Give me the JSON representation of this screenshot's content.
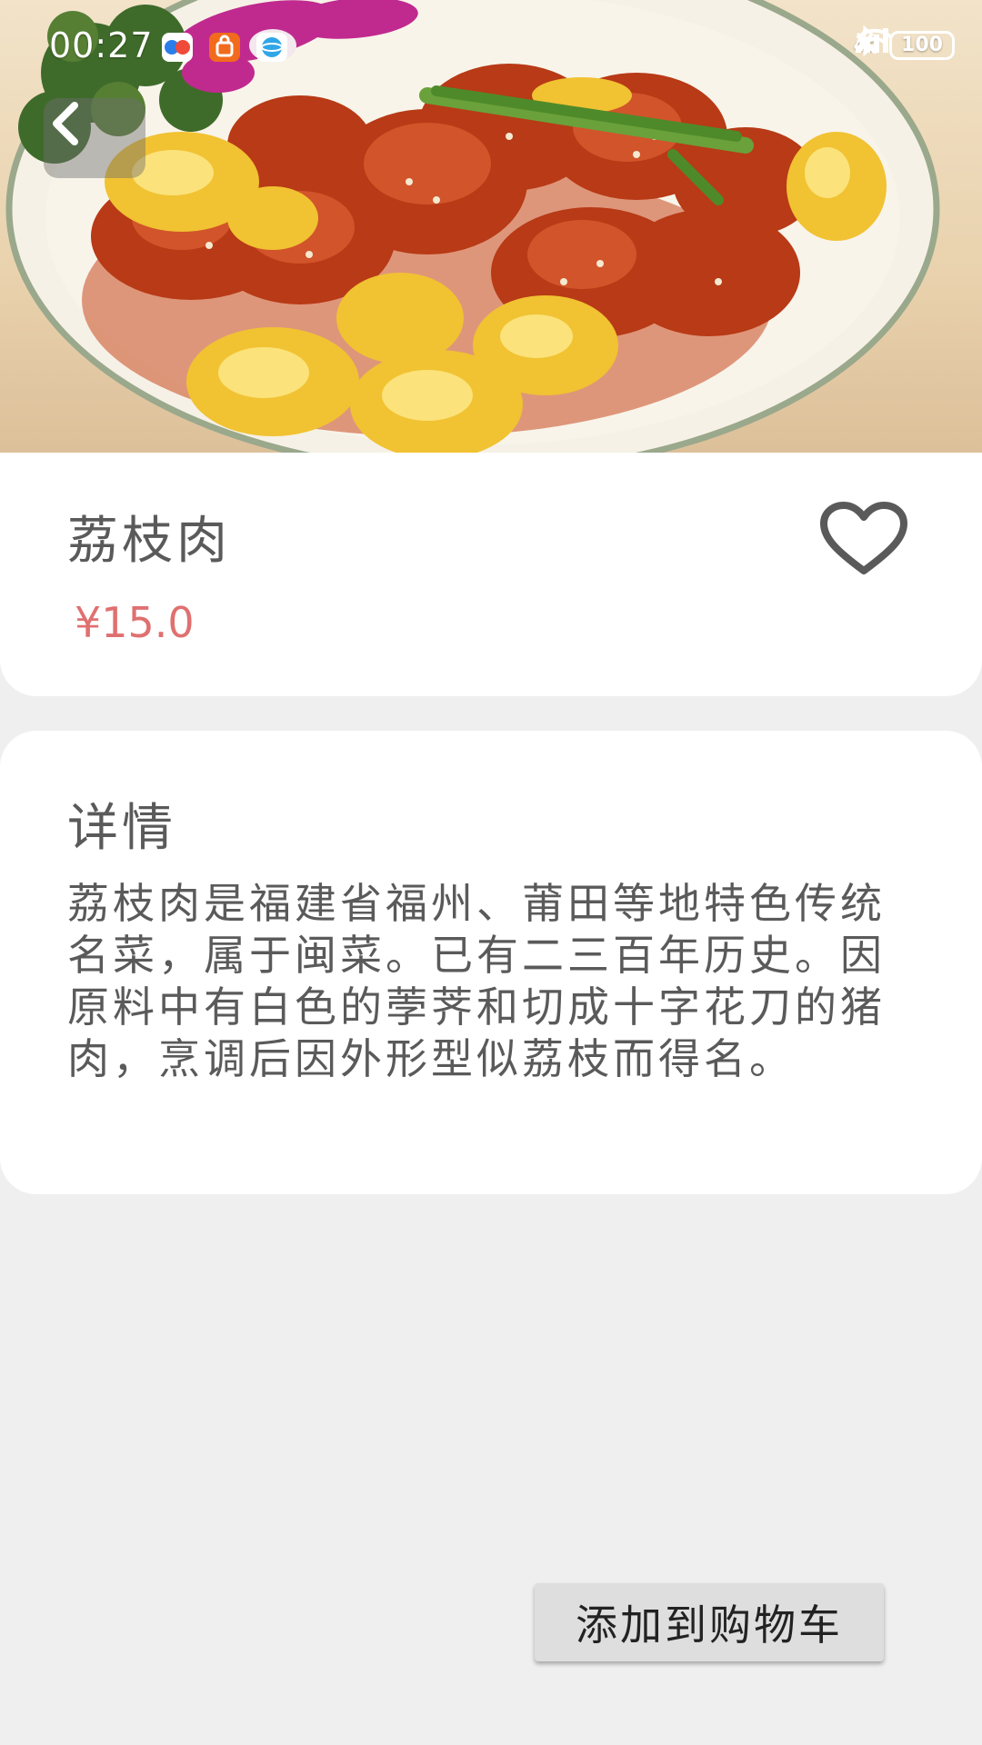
{
  "status_bar": {
    "time": "00:27",
    "network": "4G",
    "battery": "100"
  },
  "dish": {
    "name": "荔枝肉",
    "price": "¥15.0"
  },
  "details": {
    "heading": "详情",
    "description": "荔枝肉是福建省福州、莆田等地特色传统名菜，属于闽菜。已有二三百年历史。因原料中有白色的荸荠和切成十字花刀的猪肉，烹调后因外形型似荔枝而得名。"
  },
  "actions": {
    "add_to_cart": "添加到购物车"
  },
  "colors": {
    "background": "#efefef",
    "card": "#ffffff",
    "price": "#e07070",
    "text": "#5a5a5a",
    "button": "#dedede"
  },
  "icons": {
    "back": "chevron-left-icon",
    "favorite": "heart-outline-icon",
    "bluetooth": "bluetooth-icon",
    "wifi": "wifi-icon",
    "signal": "signal-bars-icon",
    "charging": "charging-bolt-icon"
  }
}
